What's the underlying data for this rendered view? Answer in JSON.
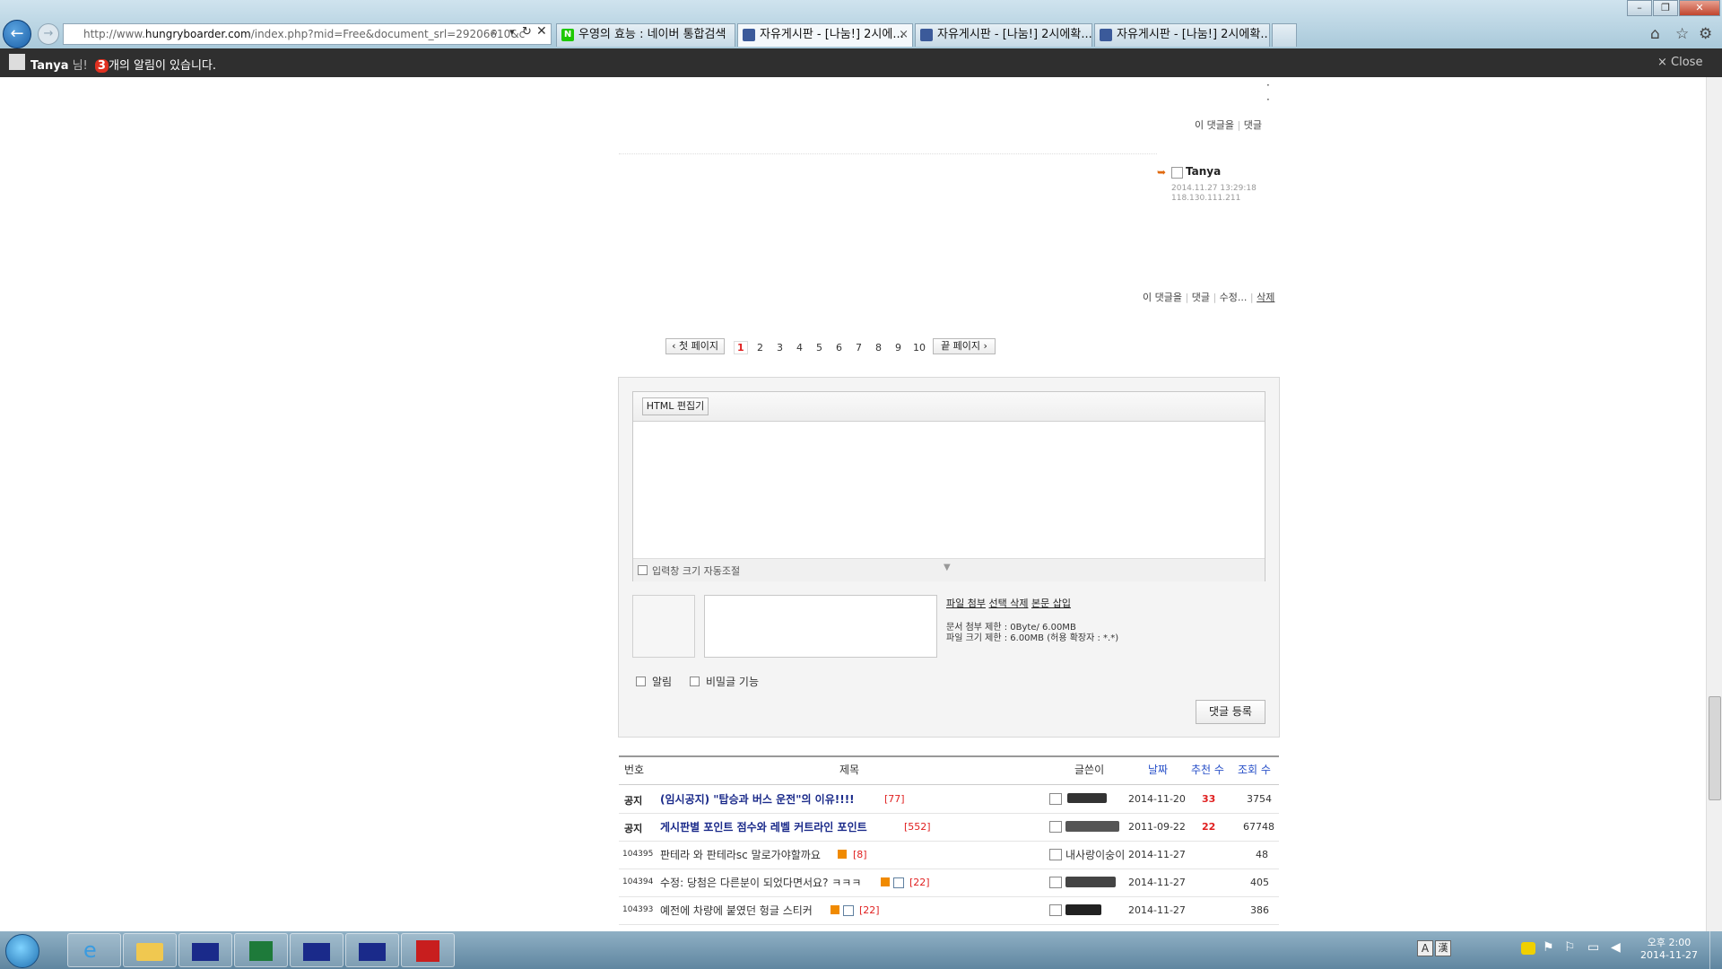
{
  "browser": {
    "url_prefix": "http://www.",
    "url_host": "hungryboarder.com",
    "url_rest": "/index.php?mid=Free&document_srl=29206610&c",
    "tabs": [
      {
        "label": "우영의 효능 : 네이버 통합검색",
        "favicon_color": "#1ec800",
        "favicon_char": "N"
      },
      {
        "label": "자유게시판 - [나눔!] 2시에...",
        "favicon_color": "#3b5a9a",
        "favicon_char": "f"
      },
      {
        "label": "자유게시판 - [나눔!] 2시에확...",
        "favicon_color": "#3b5a9a",
        "favicon_char": "f"
      },
      {
        "label": "자유게시판 - [나눔!] 2시에확...",
        "favicon_color": "#3b5a9a",
        "favicon_char": "f"
      }
    ],
    "tab_close": "×"
  },
  "notification": {
    "user": "Tanya",
    "suffix": " 님!",
    "count": "3",
    "message": "개의 알림이 있습니다.",
    "close": "× Close"
  },
  "comments": {
    "reply_label": "이 댓글을",
    "reply_action": "댓글",
    "author": "Tanya",
    "timestamp": "2014.11.27 13:29:18",
    "ip": "118.130.111.211",
    "reply_label2": "이 댓글을",
    "reply_action2": "댓글",
    "edit_action": "수정...",
    "delete_action": "삭제"
  },
  "pagination": {
    "first": "‹ 첫 페이지",
    "last": "끝 페이지 ›",
    "pages": [
      "1",
      "2",
      "3",
      "4",
      "5",
      "6",
      "7",
      "8",
      "9",
      "10"
    ],
    "current": "1"
  },
  "editor": {
    "html_button": "HTML 편집기",
    "autosize_label": "입력창 크기 자동조절",
    "attach": "파일 첨부",
    "select_delete": "선택 삭제",
    "insert_body": "본문 삽입",
    "doc_limit": "문서 첨부 제한 : 0Byte/ 6.00MB",
    "file_limit": "파일 크기 제한 : 6.00MB (허용 확장자 : *.*)",
    "notify_label": "알림",
    "secret_label": "비밀글 기능",
    "submit": "댓글 등록"
  },
  "board": {
    "headers": {
      "num": "번호",
      "title": "제목",
      "author": "글쓴이",
      "date": "날짜",
      "votes": "추천 수",
      "views": "조회 수"
    },
    "rows": [
      {
        "num": "공지",
        "title": "(임시공지) \"탑승과 버스 운전\"의 이유!!!!",
        "comments": "[77]",
        "author": "",
        "date": "2014-11-20",
        "votes": "33",
        "views": "3754",
        "notice": true
      },
      {
        "num": "공지",
        "title": "게시판별 포인트 점수와 레벨 커트라인 포인트",
        "comments": "[552]",
        "author": "",
        "date": "2011-09-22",
        "votes": "22",
        "views": "67748",
        "notice": true
      },
      {
        "num": "104395",
        "title": "판테라 와 판테라sc 말로가야할까요",
        "comments": "[8]",
        "author": "내사랑이숭이",
        "date": "2014-11-27",
        "votes": "",
        "views": "48",
        "notice": false
      },
      {
        "num": "104394",
        "title": "수정: 당첨은 다른분이 되었다면서요? ㅋㅋㅋ",
        "comments": "[22]",
        "author": "",
        "date": "2014-11-27",
        "votes": "",
        "views": "405",
        "notice": false
      },
      {
        "num": "104393",
        "title": "예전에 차량에 붙였던 헝글 스티커",
        "comments": "[22]",
        "author": "",
        "date": "2014-11-27",
        "votes": "",
        "views": "386",
        "notice": false
      }
    ]
  },
  "taskbar": {
    "time": "오후 2:00",
    "date": "2014-11-27"
  },
  "colors": {
    "accent_red": "#e02020",
    "header_blue": "#2850c8",
    "notice_title": "#1a2a8a"
  }
}
